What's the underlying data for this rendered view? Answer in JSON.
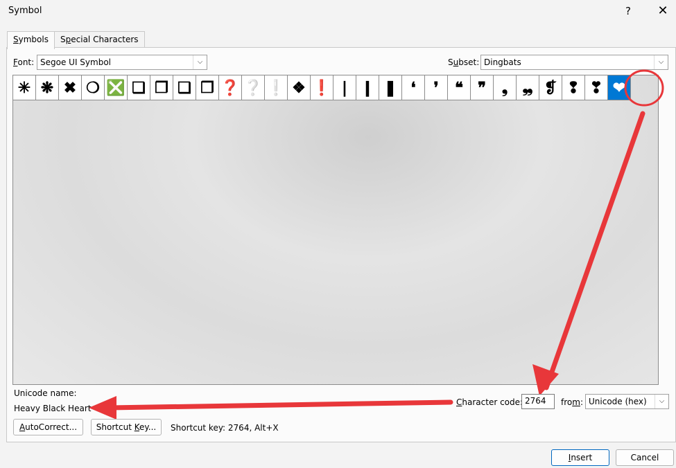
{
  "window": {
    "title": "Symbol",
    "help": "?",
    "close": "✕"
  },
  "tabs": [
    {
      "label": "Symbols",
      "access": "S",
      "rest": "ymbols"
    },
    {
      "label": "Special Characters",
      "access": "p",
      "pre": "S",
      "rest": "ecial Characters"
    }
  ],
  "font": {
    "label_access": "F",
    "label_rest": "ont:",
    "value": "Segoe UI Symbol"
  },
  "subset": {
    "label_pre": "S",
    "label_access": "u",
    "label_rest": "bset:",
    "value": "Dingbats"
  },
  "symbols": [
    "✳",
    "❋",
    "✖",
    "❍",
    "❎",
    "❏",
    "❐",
    "❑",
    "❒",
    "❓",
    "❔",
    "❕",
    "❖",
    "❗",
    "❘",
    "❙",
    "❚",
    "❛",
    "❜",
    "❝",
    "❞",
    "❟",
    "❠",
    "❡",
    "❢",
    "❣",
    "❤"
  ],
  "selected_index": 26,
  "unicode_name_label": "Unicode name:",
  "unicode_name_value": "Heavy Black Heart",
  "character_code": {
    "label_access": "C",
    "label_rest": "haracter code:",
    "value": "2764"
  },
  "from": {
    "label_pre": "fro",
    "label_access": "m",
    "label_rest": ":",
    "value": "Unicode (hex)"
  },
  "buttons": {
    "autocorrect_access": "A",
    "autocorrect_rest": "utoCorrect...",
    "shortcut_pre": "Shortcut ",
    "shortcut_access": "K",
    "shortcut_rest": "ey...",
    "insert_access": "I",
    "insert_rest": "nsert",
    "cancel": "Cancel"
  },
  "shortcut_key_text": "Shortcut key: 2764, Alt+X",
  "colors": {
    "selection": "#0078d4",
    "annotation": "#e8373a"
  }
}
